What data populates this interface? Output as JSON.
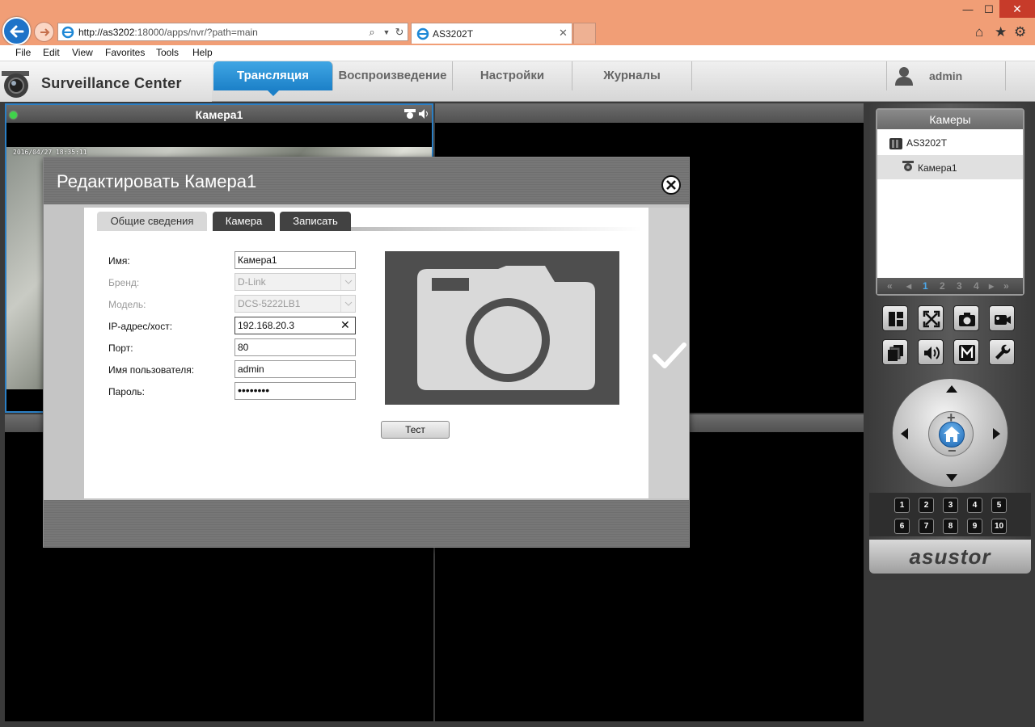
{
  "browser": {
    "url_host": "http://as3202",
    "url_rest": ":18000/apps/nvr/?path=main",
    "tab_title": "AS3202T",
    "menu": [
      "File",
      "Edit",
      "View",
      "Favorites",
      "Tools",
      "Help"
    ]
  },
  "app": {
    "title": "Surveillance Center",
    "nav": [
      "Трансляция",
      "Воспроизведение",
      "Настройки",
      "Журналы"
    ],
    "active_nav": "Трансляция",
    "user": "admin",
    "accent": "#1c80c8"
  },
  "grid": {
    "cell1_title": "Камера1",
    "cell1_timestamp": "2016/04/27 18:35:11"
  },
  "sidebar": {
    "title": "Камеры",
    "server": "AS3202T",
    "camera": "Камера1",
    "pages": [
      "1",
      "2",
      "3",
      "4"
    ],
    "current_page": "1",
    "presets": [
      "1",
      "2",
      "3",
      "4",
      "5",
      "6",
      "7",
      "8",
      "9",
      "10"
    ],
    "brand": "asustor",
    "icons": [
      "layout-icon",
      "fullscreen-icon",
      "snapshot-icon",
      "record-icon",
      "sequence-icon",
      "audio-icon",
      "manual-record-icon",
      "settings-wrench-icon"
    ]
  },
  "dialog": {
    "title": "Редактировать Камера1",
    "tabs": [
      "Общие сведения",
      "Камера",
      "Записать"
    ],
    "active_tab": "Общие сведения",
    "fields": {
      "name_label": "Имя:",
      "name_value": "Камера1",
      "brand_label": "Бренд:",
      "brand_value": "D-Link",
      "model_label": "Модель:",
      "model_value": "DCS-5222LB1",
      "ip_label": "IP-адрес/хост:",
      "ip_value": "192.168.20.3",
      "port_label": "Порт:",
      "port_value": "80",
      "user_label": "Имя пользователя:",
      "user_value": "admin",
      "password_label": "Пароль:",
      "password_value": "••••••••"
    },
    "test_button": "Тест"
  }
}
